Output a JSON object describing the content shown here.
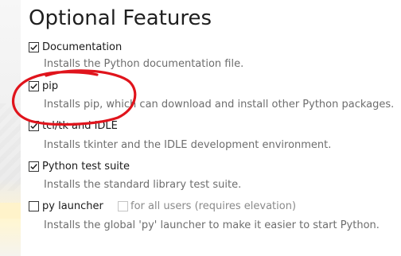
{
  "page": {
    "title": "Optional Features"
  },
  "features": [
    {
      "label": "Documentation",
      "checked": true,
      "description": "Installs the Python documentation file."
    },
    {
      "label": "pip",
      "checked": true,
      "description": "Installs pip, which can download and install other Python packages."
    },
    {
      "label": "tcl/tk and IDLE",
      "checked": true,
      "description": "Installs tkinter and the IDLE development environment."
    },
    {
      "label": "Python test suite",
      "checked": true,
      "description": "Installs the standard library test suite."
    },
    {
      "label": "py launcher",
      "checked": false,
      "description": "Installs the global 'py' launcher to make it easier to start Python.",
      "sub_option": {
        "label": "for all users (requires elevation)",
        "checked": false,
        "enabled": false
      }
    }
  ],
  "colors": {
    "annotation": "#e0141c",
    "label": "#1a1a1a",
    "description": "#6d6d6d"
  },
  "icons": {
    "checked": "checkmark-icon"
  }
}
